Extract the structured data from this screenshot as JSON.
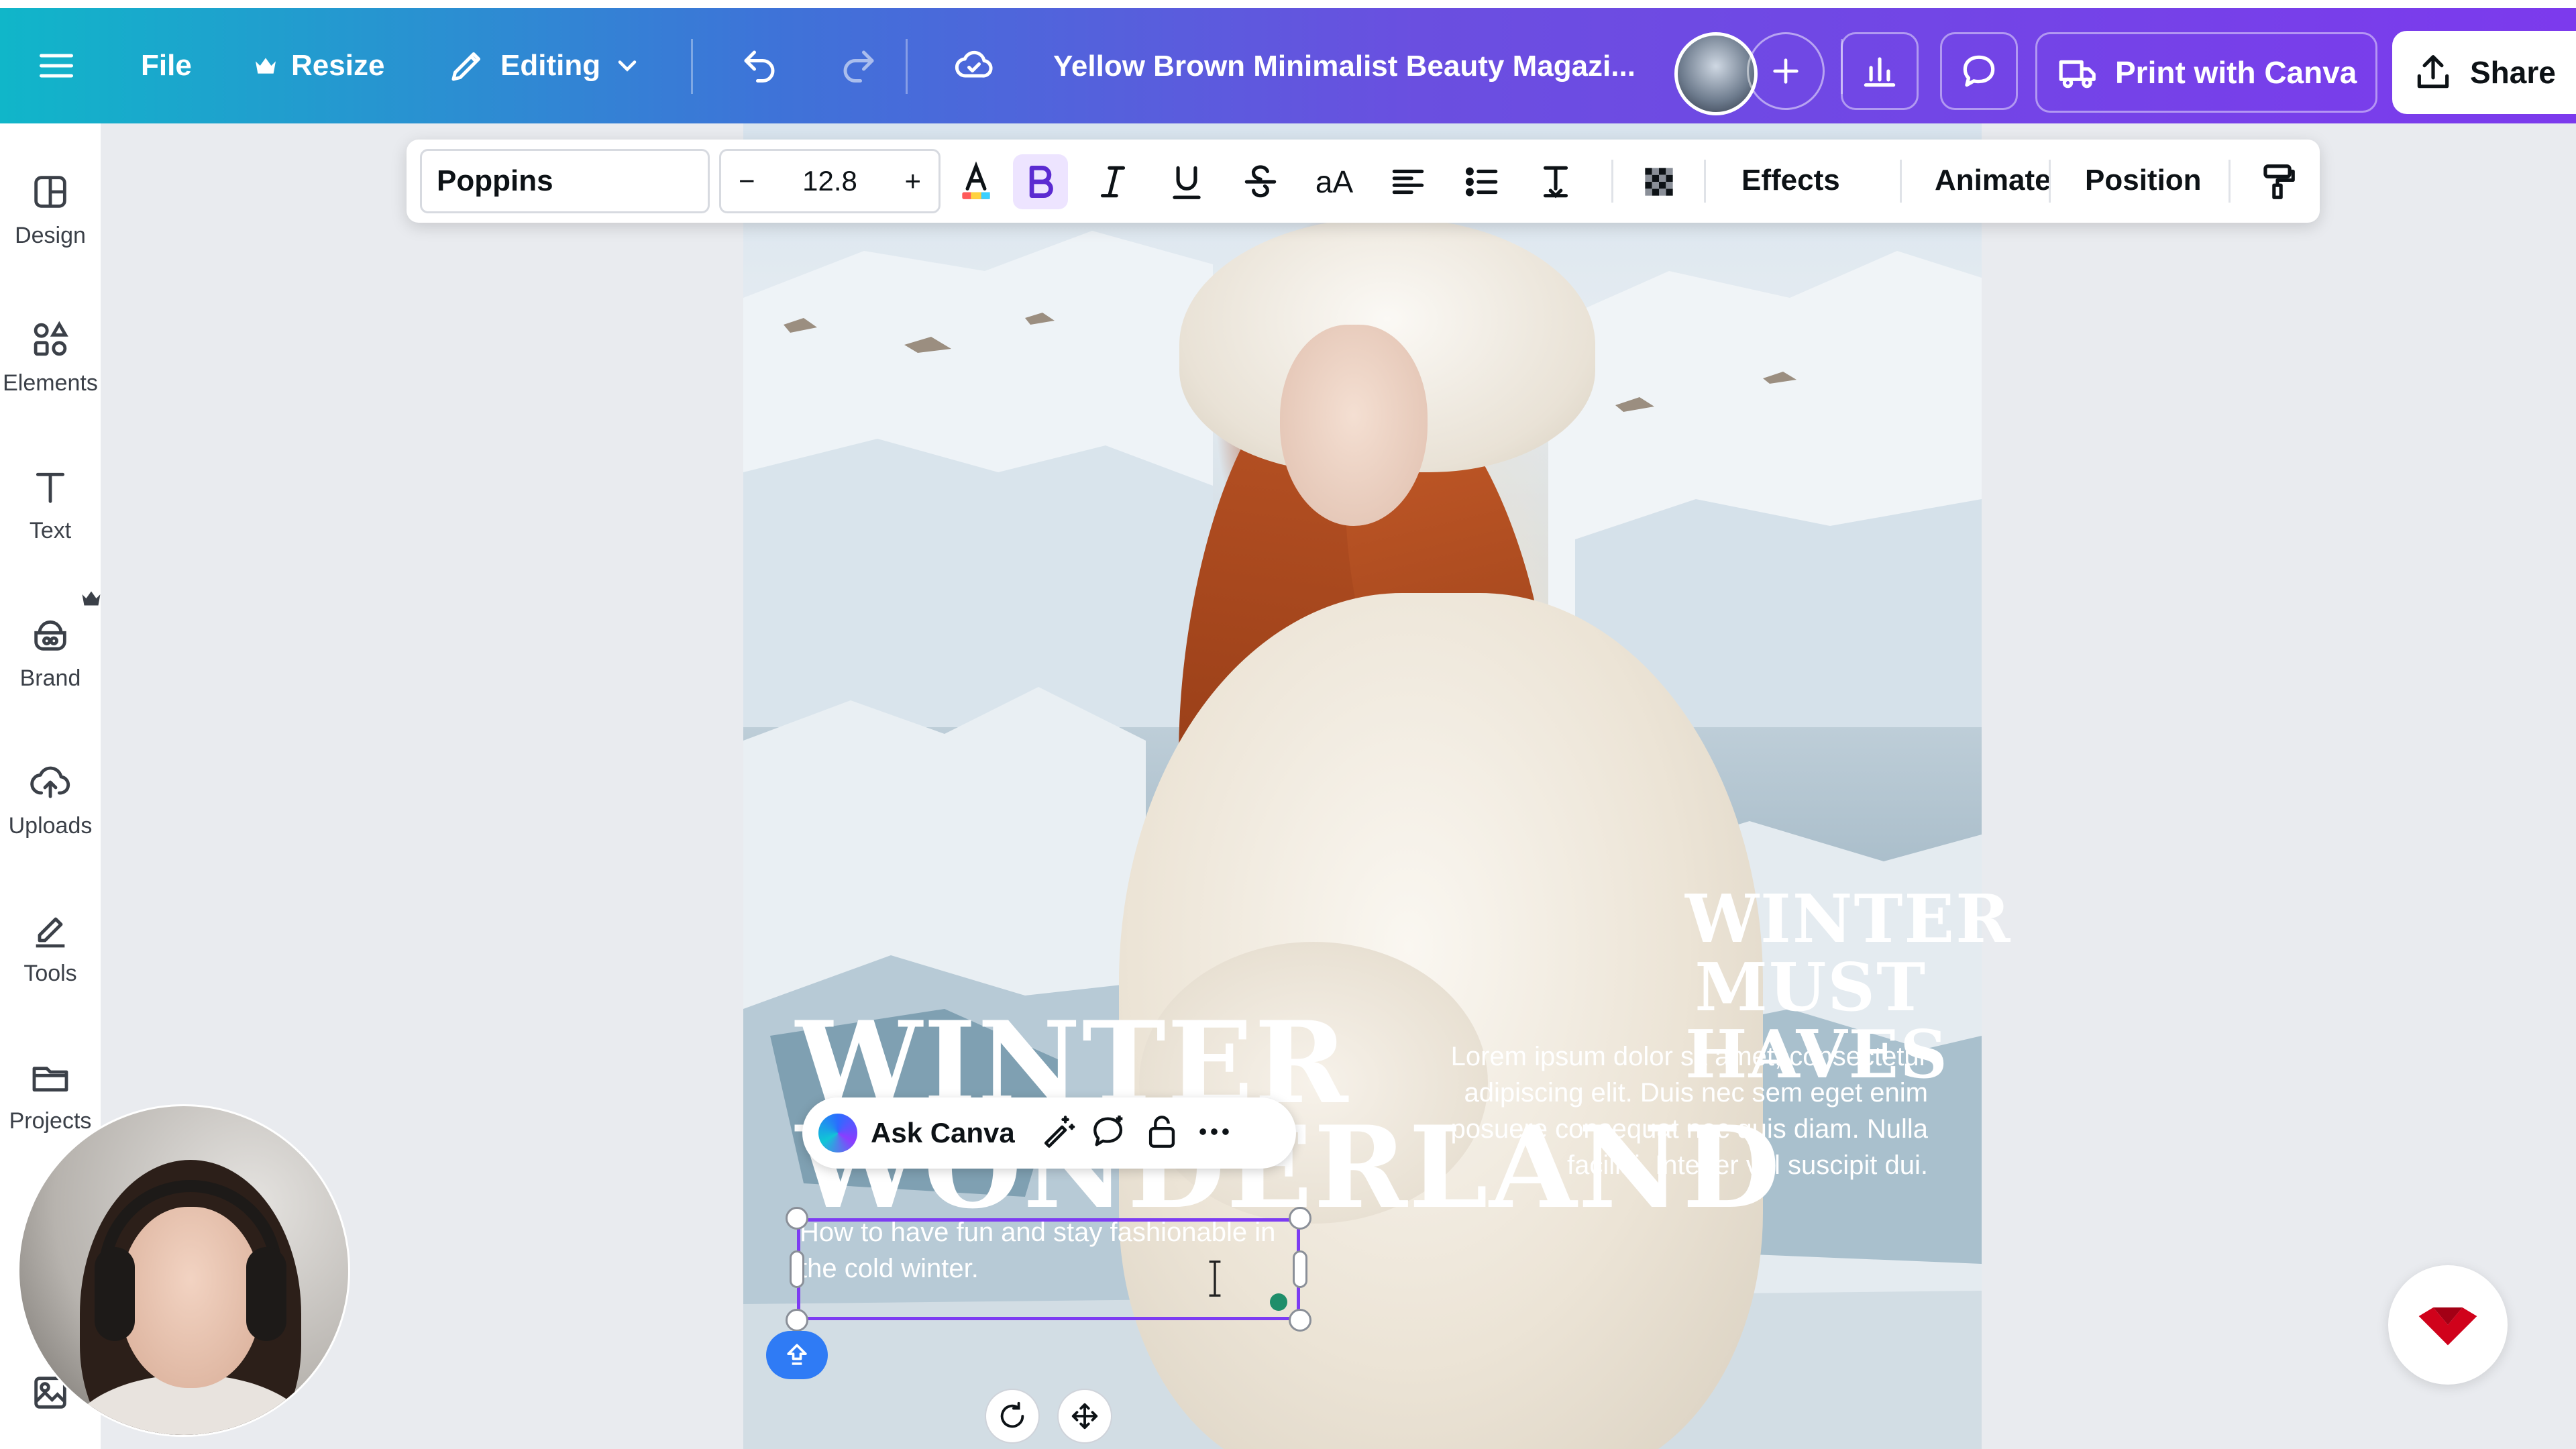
{
  "topbar": {
    "file_label": "File",
    "resize_label": "Resize",
    "editing_label": "Editing",
    "document_title": "Yellow Brown Minimalist Beauty Magazi...",
    "print_label": "Print with Canva",
    "share_label": "Share"
  },
  "sidebar": {
    "items": [
      {
        "label": "Design",
        "icon": "design-icon"
      },
      {
        "label": "Elements",
        "icon": "elements-icon"
      },
      {
        "label": "Text",
        "icon": "text-icon"
      },
      {
        "label": "Brand",
        "icon": "brand-icon"
      },
      {
        "label": "Uploads",
        "icon": "uploads-icon"
      },
      {
        "label": "Tools",
        "icon": "tools-icon"
      },
      {
        "label": "Projects",
        "icon": "projects-icon"
      }
    ]
  },
  "text_toolbar": {
    "font_name": "Poppins",
    "font_size": "12.8",
    "decrease": "−",
    "increase": "+",
    "case_label": "aA",
    "effects_label": "Effects",
    "animate_label": "Animate",
    "position_label": "Position"
  },
  "canvas": {
    "headline_left_line1": "WINTER",
    "headline_left_line2": "WONDERLAND",
    "headline_right_line1": "WINTER",
    "headline_right_line2": "MUST",
    "headline_right_line3": "HAVES",
    "lorem_text": "Lorem ipsum dolor sit amet, consectetur adipiscing elit. Duis nec sem eget enim posuere consequat nec quis diam. Nulla facilisi. Integer vel suscipit dui.",
    "selected_text": "How to have fun and stay fashionable in the cold winter."
  },
  "ask_canva": {
    "label": "Ask Canva"
  },
  "colors": {
    "selection": "#7d3cf2",
    "accent_blue": "#2f7bf5",
    "brand_red": "#d0021b"
  }
}
